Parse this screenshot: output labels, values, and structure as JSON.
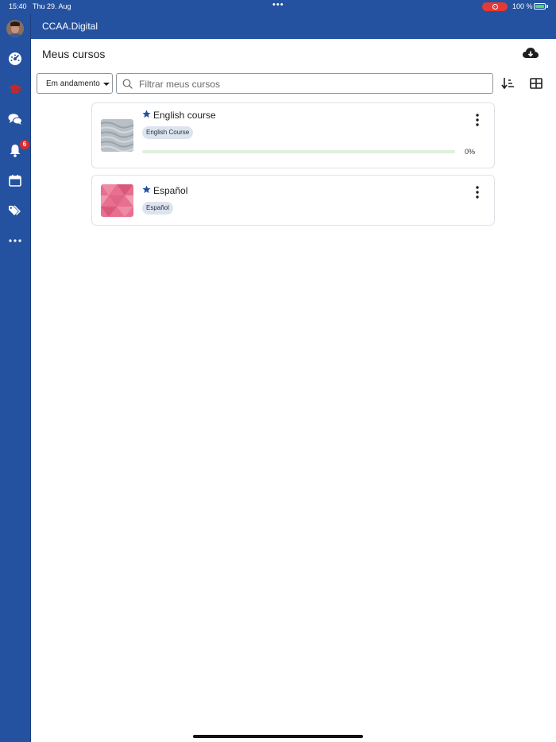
{
  "status_bar": {
    "time": "15:40",
    "date": "Thu 29. Aug",
    "battery": "100 %"
  },
  "sidebar": {
    "notification_count": "6",
    "items": [
      {
        "icon": "avatar"
      },
      {
        "icon": "dashboard-icon"
      },
      {
        "icon": "graduation-cap-icon",
        "active": true
      },
      {
        "icon": "chat-icon"
      },
      {
        "icon": "bell-icon"
      },
      {
        "icon": "calendar-icon"
      },
      {
        "icon": "tags-icon"
      },
      {
        "icon": "more-icon"
      }
    ]
  },
  "header": {
    "title": "CCAA.Digital"
  },
  "page": {
    "title": "Meus cursos"
  },
  "filters": {
    "status_selected": "Em andamento",
    "search_placeholder": "Filtrar meus cursos"
  },
  "courses": [
    {
      "title": "English course",
      "category": "English Course",
      "progress_percent": 0,
      "progress_label": "0%",
      "starred": true
    },
    {
      "title": "Español",
      "category": "Español",
      "starred": true
    }
  ],
  "colors": {
    "brand": "#2452a0",
    "active_icon": "#c62828",
    "progress": "#3f8f3f",
    "badge": "#d32f2f"
  }
}
